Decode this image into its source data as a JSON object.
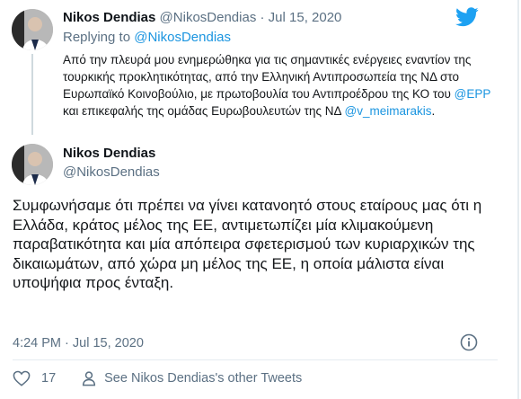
{
  "reply_tweet": {
    "author_name": "Nikos Dendias",
    "author_handle": "@NikosDendias",
    "separator": "·",
    "date": "Jul 15, 2020",
    "replying_prefix": "Replying to",
    "replying_to": "@NikosDendias",
    "text_part1": "Από την πλευρά μου ενημερώθηκα για τις σημαντικές ενέργειες εναντίον της τουρκικής προκλητικότητας, από την Ελληνική Αντιπροσωπεία της ΝΔ στο Ευρωπαϊκό Κοινοβούλιο, με πρωτοβουλία του Αντιπροέδρου της ΚΟ του ",
    "mention_epp": "@EPP",
    "text_part2": " και επικεφαλής της ομάδας Ευρωβουλευτών της ΝΔ ",
    "mention_meimarakis": "@v_meimarakis",
    "text_part3": "."
  },
  "main_tweet": {
    "author_name": "Nikos Dendias",
    "author_handle": "@NikosDendias",
    "text": "Συμφωνήσαμε ότι πρέπει να γίνει κατανοητό στους εταίρους μας ότι η Ελλάδα, κράτος μέλος της ΕΕ, αντιμετωπίζει μία κλιμακούμενη παραβατικότητα και μία απόπειρα σφετερισμού των κυριαρχικών της δικαιωμάτων, από χώρα μη μέλος της ΕΕ, η οποία μάλιστα είναι υποψήφια προς ένταξη.",
    "timestamp": "4:24 PM · Jul 15, 2020",
    "like_count": "17",
    "other_tweets_label": "See Nikos Dendias's other Tweets"
  },
  "colors": {
    "link": "#1b95e0",
    "secondary_text": "#5b7083",
    "twitter_blue": "#1da1f2"
  },
  "icons": [
    "twitter-logo-icon",
    "info-icon",
    "heart-icon",
    "person-icon"
  ]
}
